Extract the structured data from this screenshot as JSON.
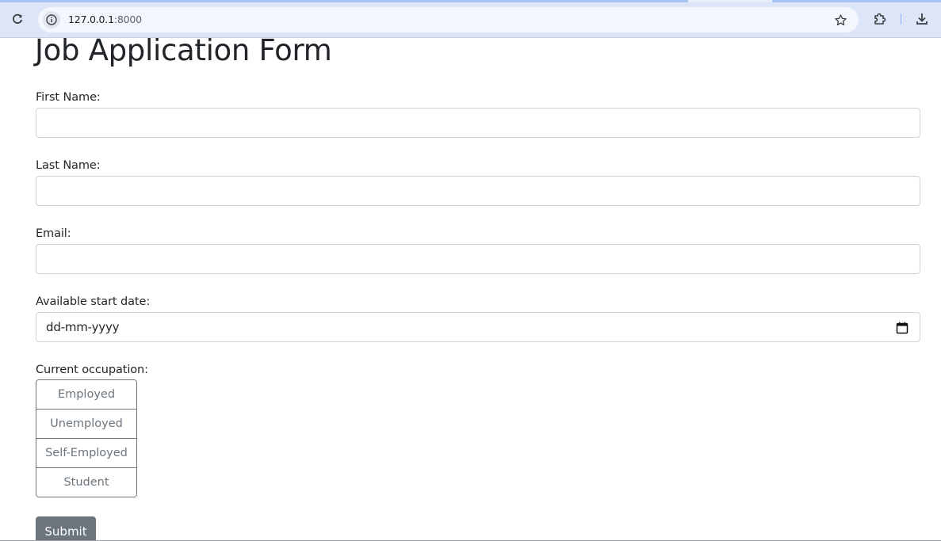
{
  "browser": {
    "url_host": "127.0.0.1",
    "url_port": ":8000",
    "icons": [
      "reload-icon",
      "site-info-icon",
      "bookmark-star-icon",
      "extensions-icon",
      "download-icon"
    ]
  },
  "form": {
    "title": "Job Application Form",
    "first_name_label": "First Name:",
    "first_name_value": "",
    "last_name_label": "Last Name:",
    "last_name_value": "",
    "email_label": "Email:",
    "email_value": "",
    "start_date_label": "Available start date:",
    "start_date_placeholder": "dd-mm-yyyy",
    "occupation_label": "Current occupation:",
    "occupation_options": [
      "Employed",
      "Unemployed",
      "Self-Employed",
      "Student"
    ],
    "submit_label": "Submit"
  },
  "colors": {
    "secondary": "#6c757d",
    "input_border": "#ced4da",
    "text": "#212529",
    "chrome_bg": "#dce6f8"
  }
}
